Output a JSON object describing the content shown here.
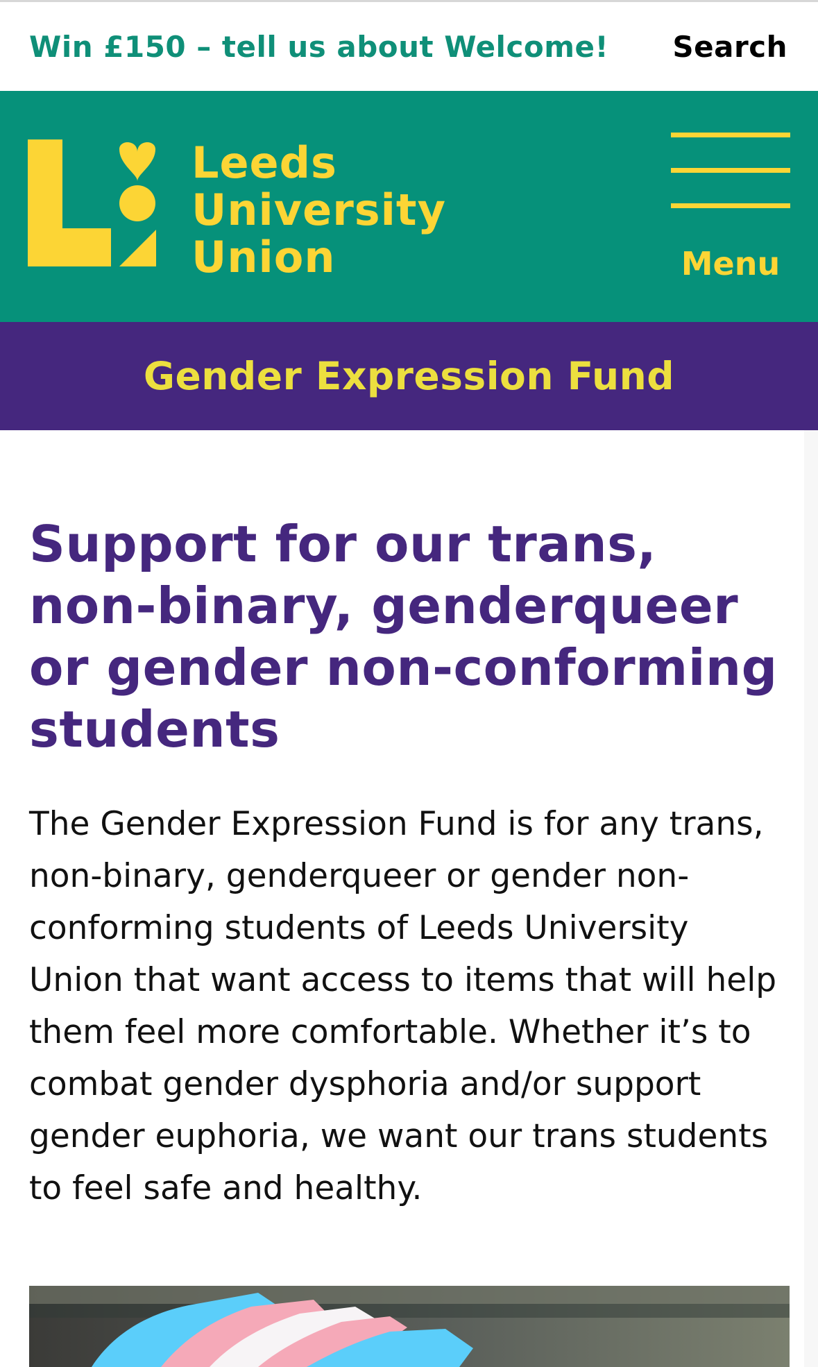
{
  "topbar": {
    "promo_text": "Win £150 – tell us about Welcome!",
    "search_label": "Search"
  },
  "header": {
    "logo_lines": [
      "Leeds",
      "University",
      "Union"
    ],
    "menu_label": "Menu"
  },
  "page": {
    "title": "Gender Expression Fund",
    "heading": "Support for our trans, non-binary, genderqueer or gender non-conforming students",
    "body": "The Gender Expression Fund is for any trans, non-binary, genderqueer or gender non-conforming students of Leeds University Union that want access to items that will help them feel more comfortable. Whether it’s to combat gender dysphoria and/or support gender euphoria, we want our trans students to feel safe and healthy."
  },
  "colors": {
    "header_green": "#06917a",
    "logo_yellow": "#fcd535",
    "band_purple": "#45277e",
    "band_title_yellow": "#ecdf3f",
    "promo_green": "#0f8f78",
    "flag_blue": "#5bcefa",
    "flag_pink": "#f5a9b8",
    "flag_white": "#ffffff"
  },
  "icons": {
    "menu": "hamburger-icon",
    "logo_mark": "luu-logo-mark"
  }
}
